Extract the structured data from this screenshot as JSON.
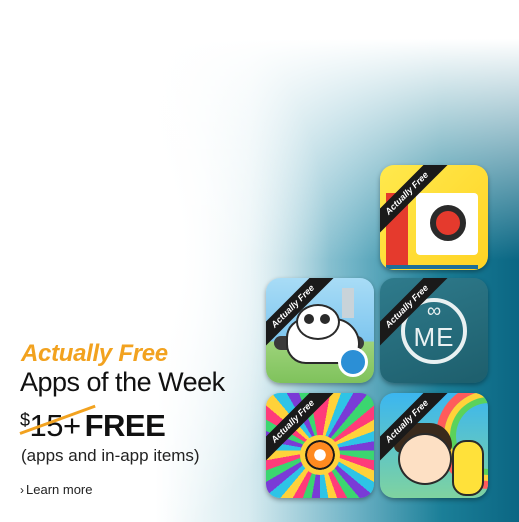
{
  "promo": {
    "tagline": "Actually Free",
    "headline": "Apps of the Week",
    "old_price_symbol": "$",
    "old_price_value": "15+",
    "new_price": "FREE",
    "subline": "(apps and in-app items)",
    "learn_more": "Learn more",
    "learn_more_arrow": "›"
  },
  "apps": [
    {
      "ribbon": "Actually Free",
      "icon": "photo-frame-icon"
    },
    {
      "ribbon": "Actually Free",
      "icon": "panda-plane-icon"
    },
    {
      "ribbon": "Actually Free",
      "icon": "me-infinity-icon",
      "glyph_top": "∞",
      "glyph_main": "ME"
    },
    {
      "ribbon": "Actually Free",
      "icon": "mandala-icon"
    },
    {
      "ribbon": "Actually Free",
      "icon": "kid-banana-icon"
    }
  ],
  "colors": {
    "accent_orange": "#f2a21f",
    "teal_bg": "#0b6683",
    "text_dark": "#111111"
  }
}
